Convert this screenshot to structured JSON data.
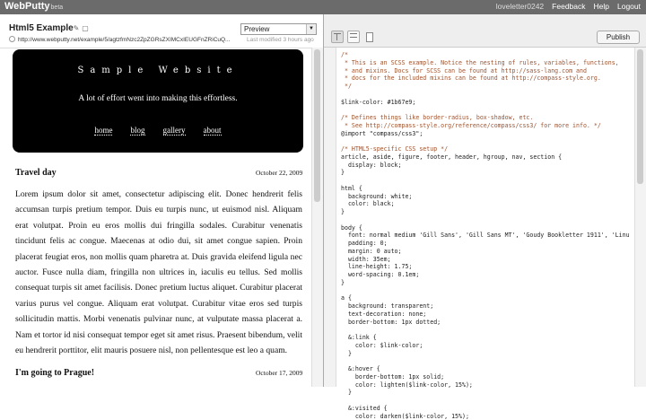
{
  "app": {
    "name": "WebPutty",
    "badge": "beta"
  },
  "top_links": {
    "user": "loveletter0242",
    "feedback": "Feedback",
    "help": "Help",
    "logout": "Logout"
  },
  "preview": {
    "title": "Html5 Example",
    "url": "http://www.webputty.net/example/5/agtzfmNzc2ZpZGRsZXIMCxIEUGFnZRiCuQ...",
    "last_modified": "Last modified 3 hours ago",
    "mode_select": "Preview"
  },
  "site": {
    "title": "Sample Website",
    "tagline": "A lot of effort went into making this effortless.",
    "nav": [
      "home",
      "blog",
      "gallery",
      "about"
    ]
  },
  "posts": [
    {
      "title": "Travel day",
      "date": "October 22, 2009",
      "body": "Lorem ipsum dolor sit amet, consectetur adipiscing elit. Donec hendrerit felis accumsan turpis pretium tempor. Duis eu turpis nunc, ut euismod nisl. Aliquam erat volutpat. Proin eu eros mollis dui fringilla sodales. Curabitur venenatis tincidunt felis ac congue. Maecenas at odio dui, sit amet congue sapien. Proin placerat feugiat eros, non mollis quam pharetra at. Duis gravida eleifend ligula nec auctor. Fusce nulla diam, fringilla non ultrices in, iaculis eu tellus. Sed mollis consequat turpis sit amet facilisis. Donec pretium luctus aliquet. Curabitur placerat varius purus vel congue. Aliquam erat volutpat. Curabitur vitae eros sed turpis sollicitudin mattis. Morbi venenatis pulvinar nunc, at vulputate massa placerat a. Nam et tortor id nisi consequat tempor eget sit amet risus. Praesent bibendum, velit eu hendrerit porttitor, elit mauris posuere nisl, non pellentesque est leo a quam."
    },
    {
      "title": "I'm going to Prague!",
      "date": "October 17, 2009"
    }
  ],
  "editor": {
    "publish_label": "Publish",
    "lines": [
      {
        "t": "/*",
        "c": true
      },
      {
        "t": " * This is an SCSS example. Notice the nesting of rules, variables, functions,",
        "c": true
      },
      {
        "t": " * and mixins. Docs for SCSS can be found at http://sass-lang.com and",
        "c": true
      },
      {
        "t": " * docs for the included mixins can be found at http://compass-style.org.",
        "c": true
      },
      {
        "t": " */",
        "c": true
      },
      {
        "t": "",
        "c": false
      },
      {
        "t": "$link-color: #1b67e9;",
        "c": false
      },
      {
        "t": "",
        "c": false
      },
      {
        "t": "/* Defines things like border-radius, box-shadow, etc.",
        "c": true
      },
      {
        "t": " * See http://compass-style.org/reference/compass/css3/ for more info. */",
        "c": true
      },
      {
        "t": "@import \"compass/css3\";",
        "c": false
      },
      {
        "t": "",
        "c": false
      },
      {
        "t": "/* HTML5-specific CSS setup */",
        "c": true
      },
      {
        "t": "article, aside, figure, footer, header, hgroup, nav, section {",
        "c": false
      },
      {
        "t": "  display: block;",
        "c": false
      },
      {
        "t": "}",
        "c": false
      },
      {
        "t": "",
        "c": false
      },
      {
        "t": "html {",
        "c": false
      },
      {
        "t": "  background: white;",
        "c": false
      },
      {
        "t": "  color: black;",
        "c": false
      },
      {
        "t": "}",
        "c": false
      },
      {
        "t": "",
        "c": false
      },
      {
        "t": "body {",
        "c": false
      },
      {
        "t": "  font: normal medium 'Gill Sans', 'Gill Sans MT', 'Goudy Bookletter 1911', 'Linu",
        "c": false
      },
      {
        "t": "  padding: 0;",
        "c": false
      },
      {
        "t": "  margin: 0 auto;",
        "c": false
      },
      {
        "t": "  width: 35em;",
        "c": false
      },
      {
        "t": "  line-height: 1.75;",
        "c": false
      },
      {
        "t": "  word-spacing: 0.1em;",
        "c": false
      },
      {
        "t": "}",
        "c": false
      },
      {
        "t": "",
        "c": false
      },
      {
        "t": "a {",
        "c": false
      },
      {
        "t": "  background: transparent;",
        "c": false
      },
      {
        "t": "  text-decoration: none;",
        "c": false
      },
      {
        "t": "  border-bottom: 1px dotted;",
        "c": false
      },
      {
        "t": "",
        "c": false
      },
      {
        "t": "  &:link {",
        "c": false
      },
      {
        "t": "    color: $link-color;",
        "c": false
      },
      {
        "t": "  }",
        "c": false
      },
      {
        "t": "",
        "c": false
      },
      {
        "t": "  &:hover {",
        "c": false
      },
      {
        "t": "    border-bottom: 1px solid;",
        "c": false
      },
      {
        "t": "    color: lighten($link-color, 15%);",
        "c": false
      },
      {
        "t": "  }",
        "c": false
      },
      {
        "t": "",
        "c": false
      },
      {
        "t": "  &:visited {",
        "c": false
      },
      {
        "t": "    color: darken($link-color, 15%);",
        "c": false
      }
    ]
  }
}
